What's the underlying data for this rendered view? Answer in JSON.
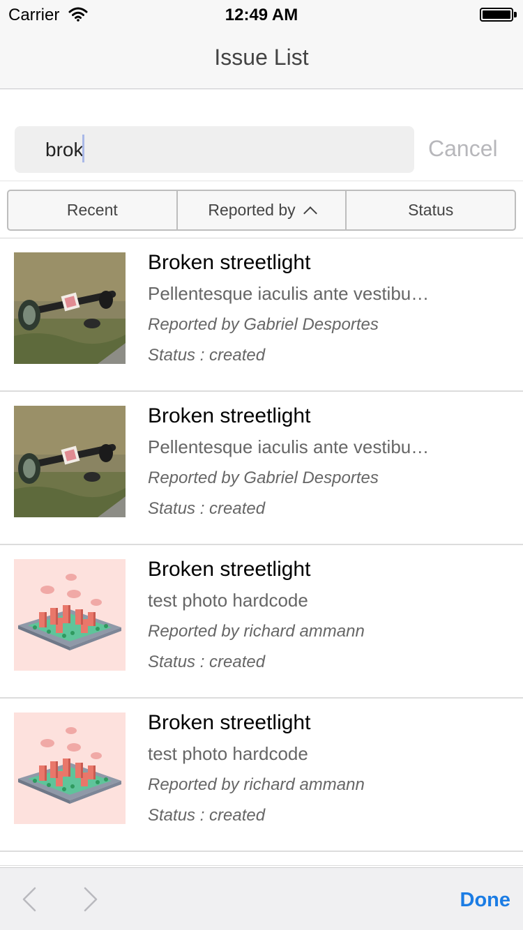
{
  "status_bar": {
    "carrier": "Carrier",
    "time": "12:49 AM",
    "wifi_icon": "wifi-icon",
    "battery_icon": "battery-icon"
  },
  "nav": {
    "title": "Issue List"
  },
  "search": {
    "value": "brok",
    "cancel_label": "Cancel"
  },
  "filters": {
    "segments": [
      {
        "label": "Recent"
      },
      {
        "label": "Reported by"
      },
      {
        "label": "Status"
      }
    ],
    "active_sort_icon": "chevron-up-icon"
  },
  "issues": [
    {
      "title": "Broken streetlight",
      "description": "Pellentesque iaculis ante vestibu…",
      "reporter": "Reported by Gabriel Desportes",
      "status": "Status : created",
      "thumbnail": "streetlight-photo"
    },
    {
      "title": "Broken streetlight",
      "description": "Pellentesque iaculis ante vestibu…",
      "reporter": "Reported by Gabriel Desportes",
      "status": "Status : created",
      "thumbnail": "streetlight-photo"
    },
    {
      "title": "Broken streetlight",
      "description": "test photo hardcode",
      "reporter": "Reported by richard ammann",
      "status": "Status : created",
      "thumbnail": "city-illustration"
    },
    {
      "title": "Broken streetlight",
      "description": "test photo hardcode",
      "reporter": "Reported by richard ammann",
      "status": "Status : created",
      "thumbnail": "city-illustration"
    }
  ],
  "toolbar": {
    "back_icon": "chevron-left-icon",
    "forward_icon": "chevron-right-icon",
    "done_label": "Done"
  },
  "colors": {
    "accent": "#1b7ce4",
    "nav_bg": "#f7f7f7",
    "search_bg": "#efefef",
    "illustration_bg": "#fde1dd"
  }
}
